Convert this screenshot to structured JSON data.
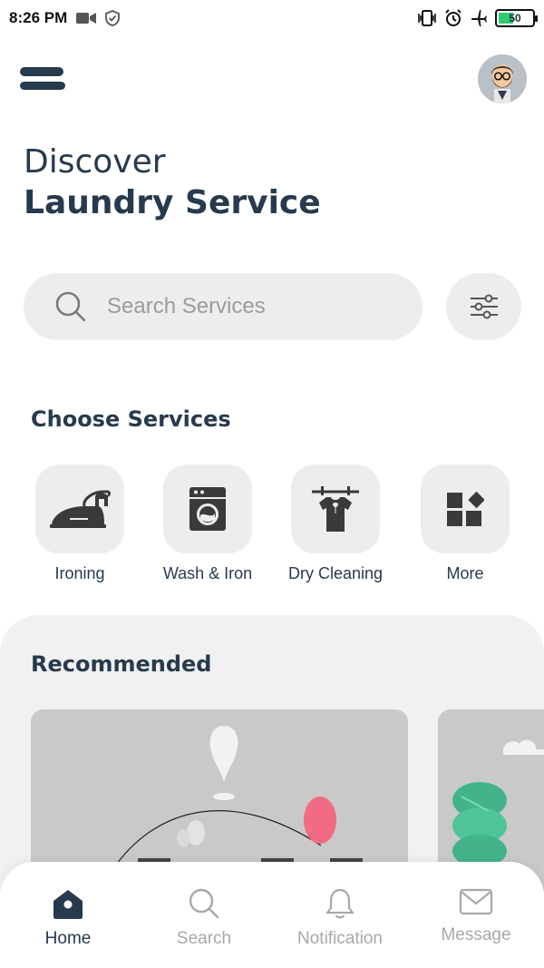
{
  "status_bar": {
    "time": "8:26 PM",
    "battery": "50"
  },
  "header": {
    "menu_icon": "menu-icon",
    "avatar_icon": "avatar"
  },
  "hero": {
    "line1": "Discover",
    "line2": "Laundry Service"
  },
  "search": {
    "placeholder": "Search Services",
    "value": ""
  },
  "choose_services": {
    "title": "Choose Services",
    "items": [
      {
        "label": "Ironing",
        "icon": "iron-icon"
      },
      {
        "label": "Wash & Iron",
        "icon": "washing-machine-icon"
      },
      {
        "label": "Dry Cleaning",
        "icon": "shirt-hanger-icon"
      },
      {
        "label": "More",
        "icon": "grid-icon"
      }
    ]
  },
  "recommended": {
    "title": "Recommended"
  },
  "bottom_nav": {
    "items": [
      {
        "label": "Home",
        "icon": "home-icon",
        "active": true
      },
      {
        "label": "Search",
        "icon": "search-icon",
        "active": false
      },
      {
        "label": "Notification",
        "icon": "bell-icon",
        "active": false
      },
      {
        "label": "Message",
        "icon": "mail-icon",
        "active": false
      }
    ]
  },
  "colors": {
    "primary": "#273a4e",
    "tile_bg": "#ededee",
    "inactive": "#a8a8a8"
  }
}
